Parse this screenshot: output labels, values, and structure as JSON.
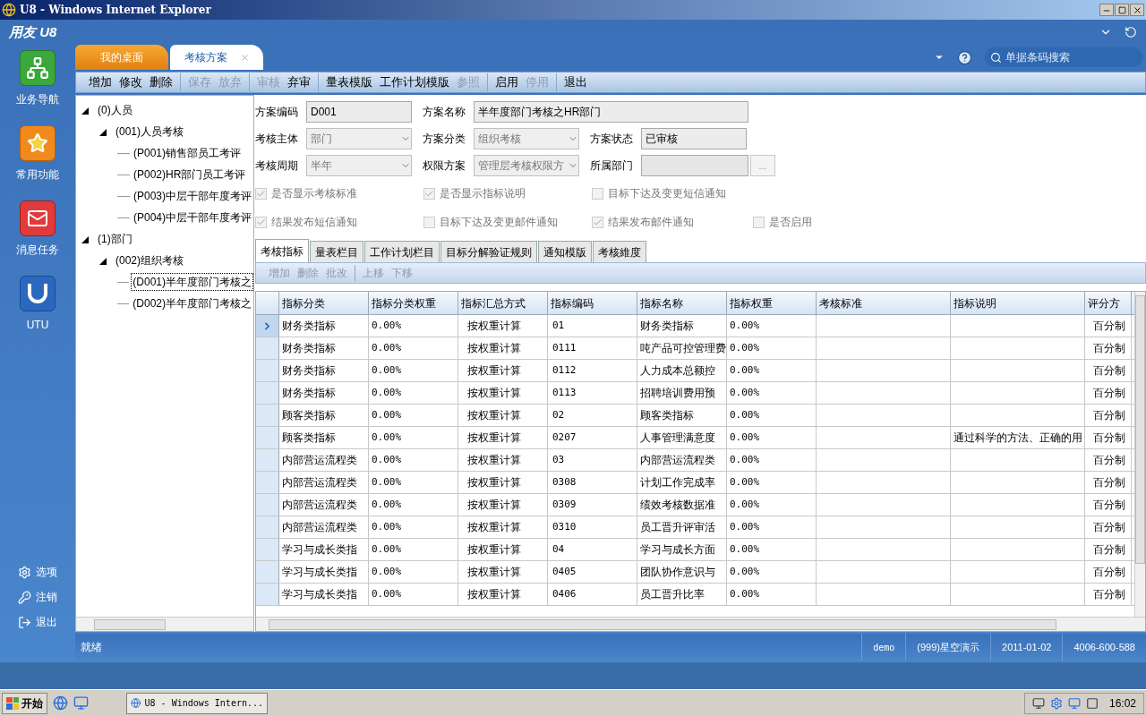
{
  "window": {
    "title": "U8 - Windows Internet Explorer"
  },
  "app": {
    "logo": "用友 U8",
    "search": {
      "placeholder": "单据条码搜索"
    }
  },
  "tabs": [
    {
      "label": "我的桌面",
      "selected": false,
      "closable": false
    },
    {
      "label": "考核方案",
      "selected": true,
      "closable": true
    }
  ],
  "toolbar": [
    [
      {
        "label": "增加",
        "disabled": false
      },
      {
        "label": "修改",
        "disabled": false
      },
      {
        "label": "删除",
        "disabled": false
      }
    ],
    [
      {
        "label": "保存",
        "disabled": true
      },
      {
        "label": "放弃",
        "disabled": true
      }
    ],
    [
      {
        "label": "审核",
        "disabled": true
      },
      {
        "label": "弃审",
        "disabled": false
      }
    ],
    [
      {
        "label": "量表模版",
        "disabled": false
      },
      {
        "label": "工作计划模版",
        "disabled": false
      },
      {
        "label": "参照",
        "disabled": true
      }
    ],
    [
      {
        "label": "启用",
        "disabled": false
      },
      {
        "label": "停用",
        "disabled": true
      }
    ],
    [
      {
        "label": "退出",
        "disabled": false
      }
    ]
  ],
  "nav": {
    "items": [
      {
        "label": "业务导航",
        "kind": "tree"
      },
      {
        "label": "常用功能",
        "kind": "star"
      },
      {
        "label": "消息任务",
        "kind": "mail"
      },
      {
        "label": "UTU",
        "kind": "utu"
      }
    ],
    "footer": [
      {
        "label": "选项",
        "kind": "settings"
      },
      {
        "label": "注销",
        "kind": "key"
      },
      {
        "label": "退出",
        "kind": "exit"
      }
    ]
  },
  "tree": [
    {
      "label": "(0)人员",
      "expanded": true,
      "selected": false,
      "children": [
        {
          "label": "(001)人员考核",
          "expanded": true,
          "selected": false,
          "children": [
            {
              "label": "(P001)销售部员工考评",
              "selected": false
            },
            {
              "label": "(P002)HR部门员工考评",
              "selected": false
            },
            {
              "label": "(P003)中层干部年度考评",
              "selected": false
            },
            {
              "label": "(P004)中层干部年度考评",
              "selected": false
            }
          ]
        }
      ]
    },
    {
      "label": "(1)部门",
      "expanded": true,
      "selected": false,
      "children": [
        {
          "label": "(002)组织考核",
          "expanded": true,
          "selected": false,
          "children": [
            {
              "label": "(D001)半年度部门考核之",
              "selected": true
            },
            {
              "label": "(D002)半年度部门考核之",
              "selected": false
            }
          ]
        }
      ]
    }
  ],
  "form": {
    "rows": [
      [
        {
          "label": "方案编码",
          "value": "D001",
          "kind": "text"
        },
        {
          "label": "方案名称",
          "value": "半年度部门考核之HR部门",
          "kind": "text"
        }
      ],
      [
        {
          "label": "考核主体",
          "value": "部门",
          "kind": "select"
        },
        {
          "label": "方案分类",
          "value": "组织考核",
          "kind": "select"
        },
        {
          "label": "方案状态",
          "value": "已审核",
          "kind": "text"
        }
      ],
      [
        {
          "label": "考核周期",
          "value": "半年",
          "kind": "select"
        },
        {
          "label": "权限方案",
          "value": "管理层考核权限方",
          "kind": "select"
        },
        {
          "label": "所属部门",
          "kind": "lookup",
          "button": "..."
        }
      ]
    ],
    "checks": [
      [
        {
          "label": "是否显示考核标准",
          "checked": true
        },
        {
          "label": "是否显示指标说明",
          "checked": true
        },
        {
          "label": "目标下达及变更短信通知",
          "checked": false
        }
      ],
      [
        {
          "label": "结果发布短信通知",
          "checked": true
        },
        {
          "label": "目标下达及变更邮件通知",
          "checked": false
        },
        {
          "label": "结果发布邮件通知",
          "checked": true
        },
        {
          "label": "是否启用",
          "checked": false
        }
      ]
    ]
  },
  "detail_tabs": [
    {
      "label": "考核指标",
      "selected": true
    },
    {
      "label": "量表栏目",
      "selected": false
    },
    {
      "label": "工作计划栏目",
      "selected": false
    },
    {
      "label": "目标分解验证规则",
      "selected": false
    },
    {
      "label": "通知模版",
      "selected": false
    },
    {
      "label": "考核維度",
      "selected": false
    }
  ],
  "sub_toolbar": [
    [
      {
        "label": "增加",
        "disabled": true
      },
      {
        "label": "删除",
        "disabled": true
      },
      {
        "label": "批改",
        "disabled": true
      }
    ],
    [
      {
        "label": "上移",
        "disabled": true
      },
      {
        "label": "下移",
        "disabled": true
      }
    ]
  ],
  "table": {
    "columns": [
      "指标分类",
      "指标分类权重",
      "指标汇总方式",
      "指标编码",
      "指标名称",
      "指标权重",
      "考核标准",
      "指标说明",
      "评分方"
    ],
    "rows": [
      {
        "selected": true,
        "cells": [
          "财务类指标",
          "0.00%",
          "按权重计算",
          "01",
          "财务类指标",
          "0.00%",
          "",
          "",
          "百分制"
        ]
      },
      {
        "selected": false,
        "cells": [
          "财务类指标",
          "0.00%",
          "按权重计算",
          "0111",
          "吨产品可控管理费",
          "0.00%",
          "",
          "",
          "百分制"
        ]
      },
      {
        "selected": false,
        "cells": [
          "财务类指标",
          "0.00%",
          "按权重计算",
          "0112",
          "人力成本总额控",
          "0.00%",
          "",
          "",
          "百分制"
        ]
      },
      {
        "selected": false,
        "cells": [
          "财务类指标",
          "0.00%",
          "按权重计算",
          "0113",
          "招聘培训费用预",
          "0.00%",
          "",
          "",
          "百分制"
        ]
      },
      {
        "selected": false,
        "cells": [
          "顾客类指标",
          "0.00%",
          "按权重计算",
          "02",
          "顾客类指标",
          "0.00%",
          "",
          "",
          "百分制"
        ]
      },
      {
        "selected": false,
        "cells": [
          "顾客类指标",
          "0.00%",
          "按权重计算",
          "0207",
          "人事管理满意度",
          "0.00%",
          "",
          "通过科学的方法、正确的用",
          "百分制"
        ]
      },
      {
        "selected": false,
        "cells": [
          "内部营运流程类",
          "0.00%",
          "按权重计算",
          "03",
          "内部营运流程类",
          "0.00%",
          "",
          "",
          "百分制"
        ]
      },
      {
        "selected": false,
        "cells": [
          "内部营运流程类",
          "0.00%",
          "按权重计算",
          "0308",
          "计划工作完成率",
          "0.00%",
          "",
          "",
          "百分制"
        ]
      },
      {
        "selected": false,
        "cells": [
          "内部营运流程类",
          "0.00%",
          "按权重计算",
          "0309",
          "绩效考核数据准",
          "0.00%",
          "",
          "",
          "百分制"
        ]
      },
      {
        "selected": false,
        "cells": [
          "内部营运流程类",
          "0.00%",
          "按权重计算",
          "0310",
          "员工晋升评审活",
          "0.00%",
          "",
          "",
          "百分制"
        ]
      },
      {
        "selected": false,
        "cells": [
          "学习与成长类指",
          "0.00%",
          "按权重计算",
          "04",
          "学习与成长方面",
          "0.00%",
          "",
          "",
          "百分制"
        ]
      },
      {
        "selected": false,
        "cells": [
          "学习与成长类指",
          "0.00%",
          "按权重计算",
          "0405",
          "团队协作意识与",
          "0.00%",
          "",
          "",
          "百分制"
        ]
      },
      {
        "selected": false,
        "cells": [
          "学习与成长类指",
          "0.00%",
          "按权重计算",
          "0406",
          "员工晋升比率",
          "0.00%",
          "",
          "",
          "百分制"
        ]
      }
    ]
  },
  "status_bar": {
    "message": "就绪",
    "fields": [
      "demo",
      "(999)星空演示",
      "2011-01-02",
      "4006-600-588"
    ]
  },
  "taskbar": {
    "start": "开始",
    "tasks": [
      {
        "label": "U8 - Windows Intern...",
        "selected": true
      }
    ],
    "clock": "16:02"
  }
}
